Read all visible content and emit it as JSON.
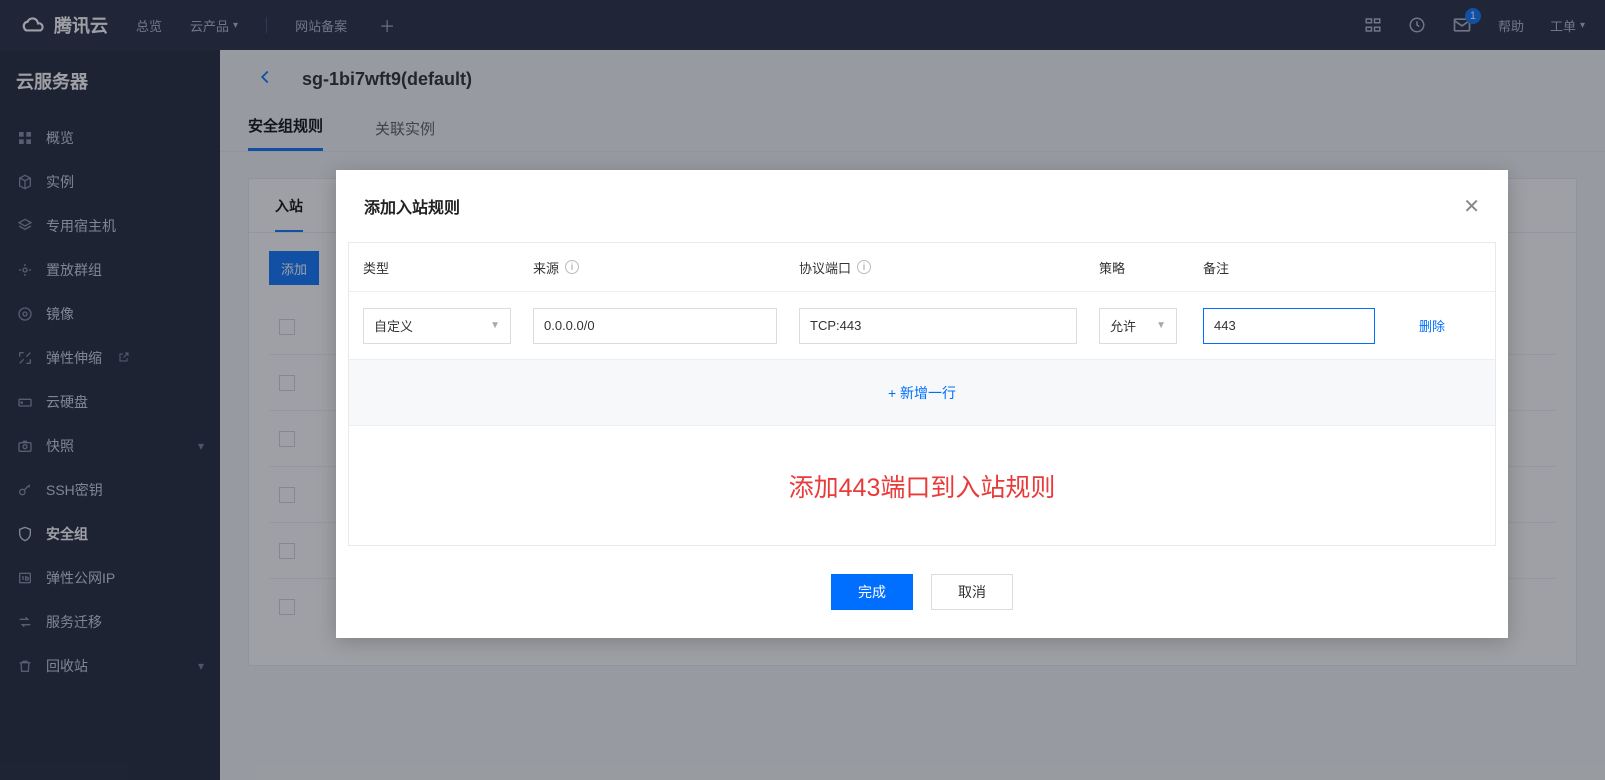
{
  "topbar": {
    "brand": "腾讯云",
    "nav1": "总览",
    "nav2": "云产品",
    "nav3": "网站备案",
    "help": "帮助",
    "ticket": "工单",
    "mail_badge": "1"
  },
  "sidebar": {
    "title": "云服务器",
    "items": [
      {
        "label": "概览"
      },
      {
        "label": "实例"
      },
      {
        "label": "专用宿主机"
      },
      {
        "label": "置放群组"
      },
      {
        "label": "镜像"
      },
      {
        "label": "弹性伸缩",
        "external": true
      },
      {
        "label": "云硬盘"
      },
      {
        "label": "快照",
        "chevron": true
      },
      {
        "label": "SSH密钥"
      },
      {
        "label": "安全组",
        "active": true
      },
      {
        "label": "弹性公网IP"
      },
      {
        "label": "服务迁移"
      },
      {
        "label": "回收站",
        "chevron": true
      }
    ]
  },
  "main": {
    "page_title": "sg-1bi7wft9(default)",
    "tabs": [
      {
        "label": "安全组规则",
        "active": true
      },
      {
        "label": "关联实例"
      }
    ],
    "subtab_partial": "入站",
    "add_rule_btn_partial": "添加"
  },
  "modal": {
    "title": "添加入站规则",
    "columns": {
      "type": "类型",
      "source": "来源",
      "port": "协议端口",
      "policy": "策略",
      "remark": "备注"
    },
    "row": {
      "type_value": "自定义",
      "source_value": "0.0.0.0/0",
      "port_value": "TCP:443",
      "policy_value": "允许",
      "remark_value": "443"
    },
    "delete_label": "删除",
    "add_line_label": "+ 新增一行",
    "annotation": "添加443端口到入站规则",
    "btn_ok": "完成",
    "btn_cancel": "取消"
  }
}
